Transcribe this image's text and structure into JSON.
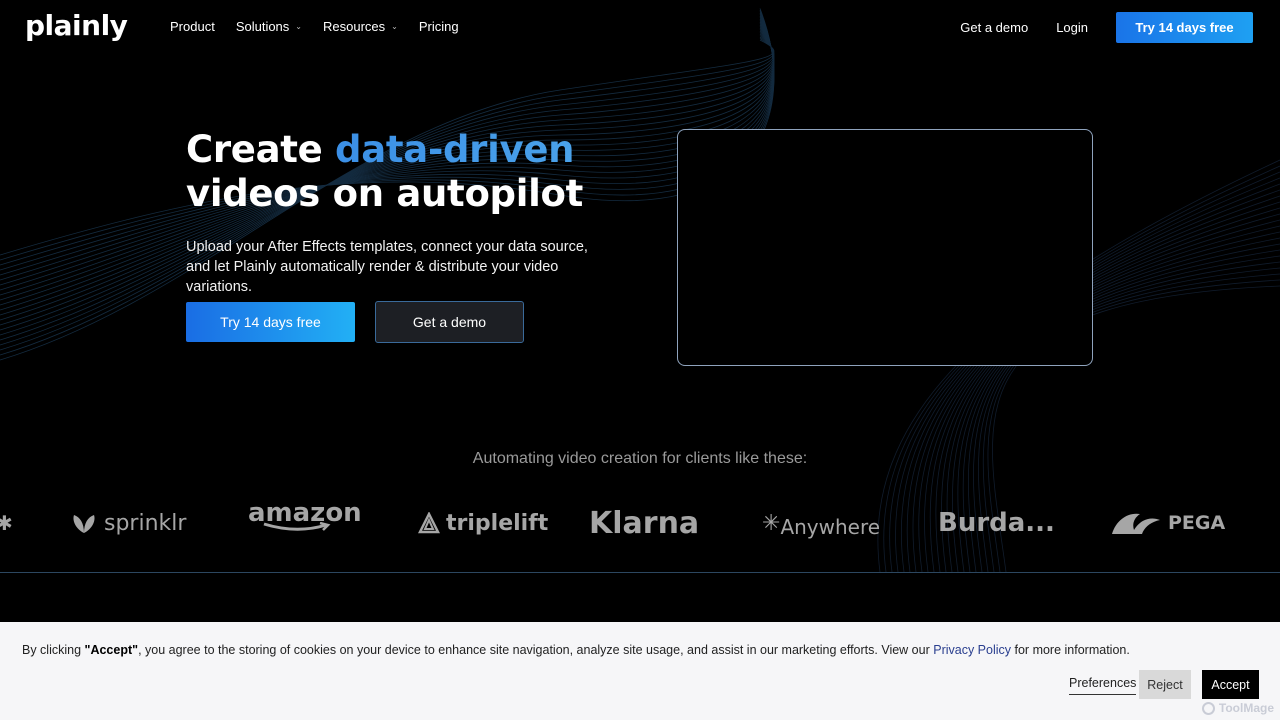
{
  "nav": {
    "logo": "plainly",
    "links": [
      {
        "label": "Product",
        "has_dropdown": false
      },
      {
        "label": "Solutions",
        "has_dropdown": true
      },
      {
        "label": "Resources",
        "has_dropdown": true
      },
      {
        "label": "Pricing",
        "has_dropdown": false
      }
    ],
    "demo_label": "Get a demo",
    "login_label": "Login",
    "cta_label": "Try 14 days free"
  },
  "hero": {
    "title_prefix": "Create ",
    "title_accent": "data-driven",
    "title_line2": "videos on autopilot",
    "subtitle": "Upload your After Effects templates, connect your data source, and let Plainly automatically render & distribute your video variations.",
    "primary_button": "Try 14 days free",
    "secondary_button": "Get a demo"
  },
  "clients": {
    "title": "Automating video creation for clients like these:",
    "logos": [
      "sprinklr",
      "amazon",
      "triplelift",
      "Klarna",
      "Anywhere",
      "Burda...",
      "PEGA"
    ]
  },
  "cookie": {
    "text_prefix": "By clicking ",
    "text_bold": "\"Accept\"",
    "text_middle": ", you agree to the storing of cookies on your device to enhance site navigation, analyze site usage, and assist in our marketing efforts. View our ",
    "link": "Privacy Policy",
    "text_suffix": " for more information.",
    "preferences": "Preferences",
    "reject": "Reject",
    "accept": "Accept"
  },
  "watermark": "ToolMage",
  "colors": {
    "accent": "#3b8fe6",
    "cta_gradient_start": "#1a6de4",
    "cta_gradient_end": "#22b0f5",
    "background": "#000000"
  }
}
